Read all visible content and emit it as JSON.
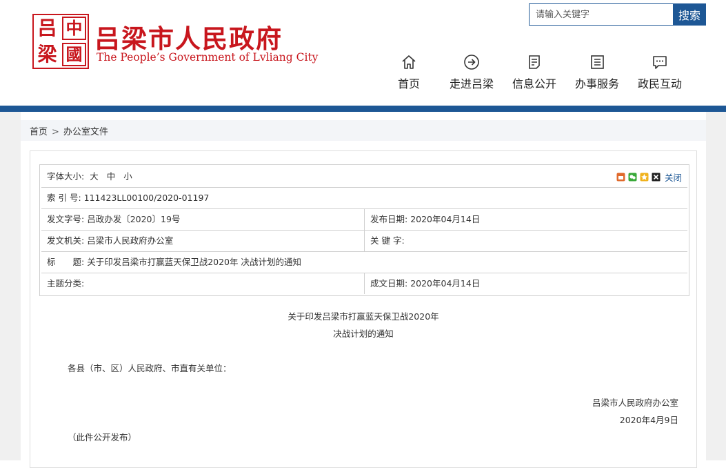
{
  "header": {
    "logo_chars": [
      "吕",
      "中",
      "梁",
      "國"
    ],
    "title": "吕梁市人民政府",
    "subtitle": "The People’s Government of Lvliang City",
    "search_placeholder": "请输入关键字",
    "search_button": "搜索",
    "nav": [
      {
        "label": "首页",
        "icon": "home-icon"
      },
      {
        "label": "走进吕梁",
        "icon": "arrow-circle-icon"
      },
      {
        "label": "信息公开",
        "icon": "document-icon"
      },
      {
        "label": "办事服务",
        "icon": "list-icon"
      },
      {
        "label": "政民互动",
        "icon": "chat-icon"
      }
    ]
  },
  "breadcrumb": {
    "home": "首页",
    "separator": ">",
    "current": "办公室文件"
  },
  "info_table": {
    "font_size_label": "字体大小:",
    "font_sizes": [
      "大",
      "中",
      "小"
    ],
    "close_label": "关闭",
    "index_label": "索 引 号:",
    "index_value": "111423LL00100/2020-01197",
    "doc_no_label": "发文字号:",
    "doc_no_value": "吕政办发〔2020〕19号",
    "pub_date_label": "发布日期:",
    "pub_date_value": "2020年04月14日",
    "issuer_label": "发文机关:",
    "issuer_value": "吕梁市人民政府办公室",
    "keywords_label": "关 键 字:",
    "keywords_value": "",
    "title_label": "标　　题:",
    "title_value": "关于印发吕梁市打赢蓝天保卫战2020年 决战计划的通知",
    "topic_label": "主题分类:",
    "topic_value": "",
    "created_label": "成文日期:",
    "created_value": "2020年04月14日"
  },
  "article": {
    "title_line1": "关于印发吕梁市打赢蓝天保卫战2020年",
    "title_line2": "决战计划的通知",
    "salutation": "各县（市、区）人民政府、市直有关单位：",
    "signature": "吕梁市人民政府办公室",
    "date": "2020年4月9日",
    "note": "（此件公开发布）"
  },
  "colors": {
    "brand_red": "#c8161d",
    "brand_blue": "#1d5795"
  }
}
